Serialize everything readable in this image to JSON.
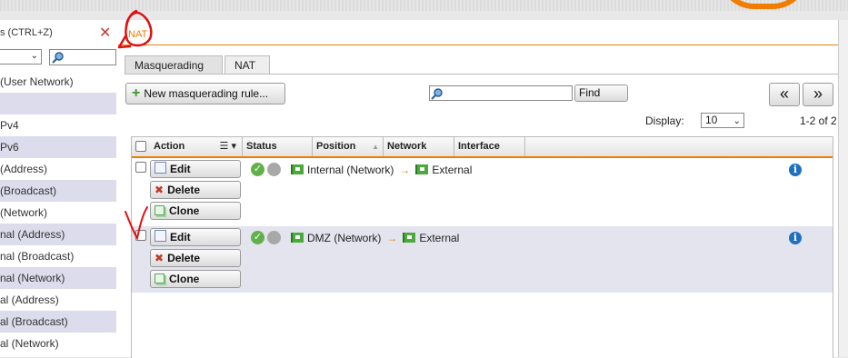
{
  "left_panel": {
    "title": "s (CTRL+Z)",
    "items": [
      "(User Network)",
      "",
      "Pv4",
      "Pv6",
      "(Address)",
      "(Broadcast)",
      "(Network)",
      "nal (Address)",
      "nal (Broadcast)",
      "nal (Network)",
      "al (Address)",
      "al (Broadcast)",
      "al (Network)"
    ]
  },
  "breadcrumb": "NAT",
  "tabs": [
    "Masquerading",
    "NAT"
  ],
  "toolbar": {
    "new_rule_label": "New masquerading rule...",
    "find_label": "Find",
    "prev_label": "«",
    "next_label": "»",
    "display_label": "Display:",
    "display_value": "10",
    "count_label": "1-2 of 2"
  },
  "table": {
    "columns": [
      "Action",
      "Status",
      "Position",
      "Network",
      "Interface"
    ],
    "action_labels": {
      "edit": "Edit",
      "delete": "Delete",
      "clone": "Clone"
    },
    "rows": [
      {
        "source": "Internal (Network)",
        "target": "External"
      },
      {
        "source": "DMZ (Network)",
        "target": "External"
      }
    ]
  },
  "colors": {
    "accent": "#f07d00",
    "row_alt": "#e4e4ef",
    "annotation": "#e01010"
  }
}
